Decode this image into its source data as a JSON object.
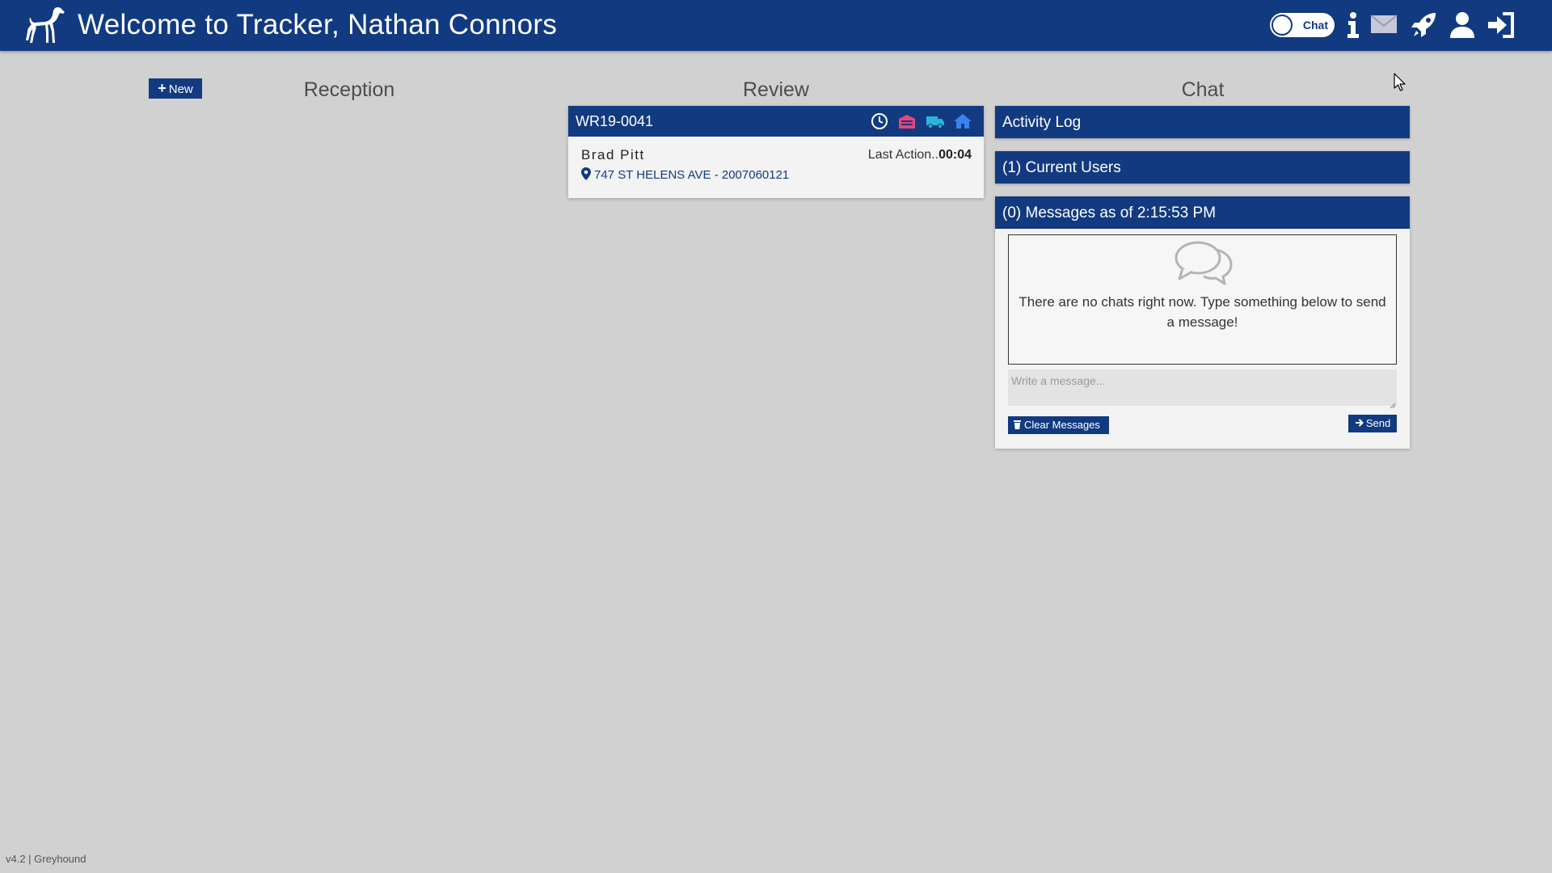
{
  "header": {
    "title": "Welcome to Tracker, Nathan Connors",
    "chat_toggle_label": "Chat",
    "icons": [
      "dog-logo-icon",
      "info-icon",
      "envelope-icon",
      "rocket-icon",
      "user-icon",
      "sign-out-icon"
    ]
  },
  "columns": {
    "new_button_label": "New",
    "reception_title": "Reception",
    "review_title": "Review",
    "chat_title": "Chat"
  },
  "review_card": {
    "id": "WR19-0041",
    "name": "Brad Pitt",
    "last_action_label": "Last Action..",
    "last_action_time": "00:04",
    "address": "747 ST HELENS AVE - 2007060121",
    "status_icons": [
      "clock-icon",
      "garage-icon",
      "truck-icon",
      "home-icon"
    ]
  },
  "chat": {
    "activity_log_label": "Activity Log",
    "current_users_label": "(1) Current Users",
    "messages_label": "(0) Messages as of 2:15:53 PM",
    "empty_text": "There are no chats right now. Type something below to send a message!",
    "input_placeholder": "Write a message...",
    "clear_button_label": "Clear Messages",
    "send_button_label": "Send"
  },
  "footer": {
    "version": "v4.2 | Greyhound"
  },
  "colors": {
    "primary": "#123a80",
    "background": "#d1d1d1",
    "card_background": "#f3f3f3",
    "icon_clock": "#ffffff",
    "icon_garage": "#e8467c",
    "icon_truck": "#2bb3d8",
    "icon_home": "#3a82f0"
  }
}
